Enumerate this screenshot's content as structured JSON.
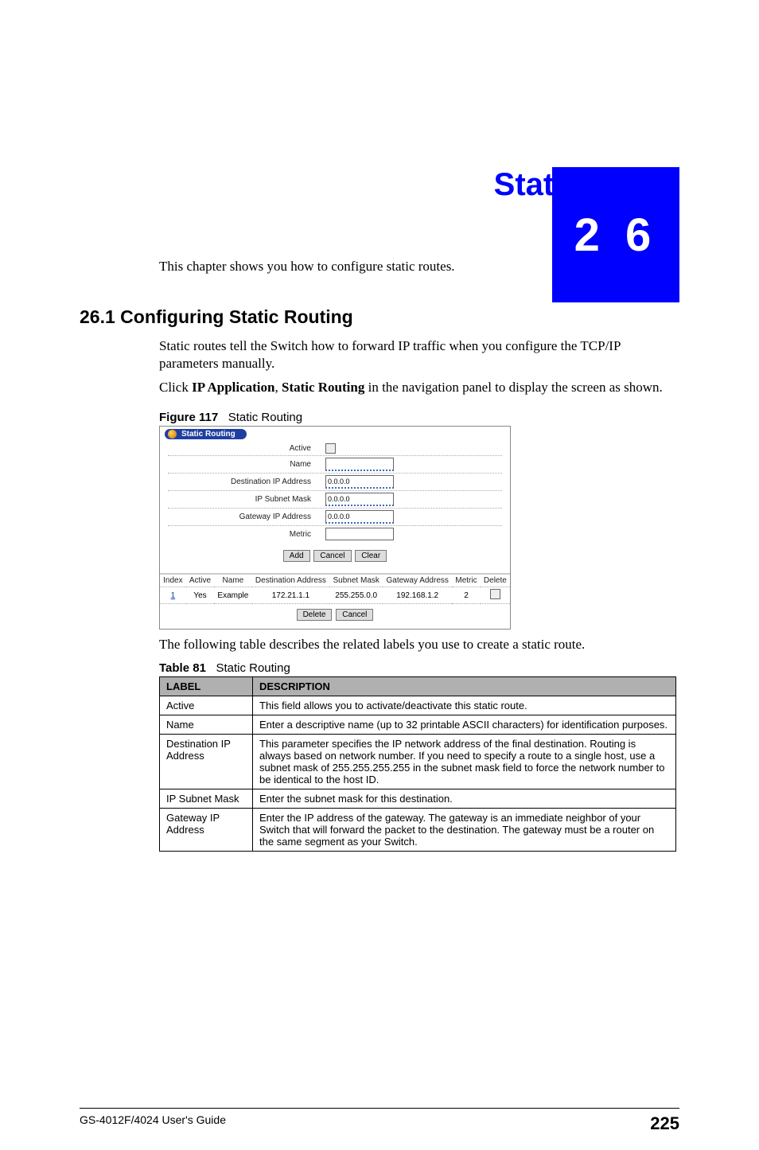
{
  "chapter_number": "2 6",
  "chapter_title": "Static Route",
  "intro": "This chapter shows you how to configure static routes.",
  "section_heading": "26.1  Configuring Static Routing",
  "para1": "Static routes tell the Switch how to forward IP traffic when you configure the TCP/IP parameters manually.",
  "para2_pre": "Click ",
  "para2_b1": "IP Application",
  "para2_sep": ", ",
  "para2_b2": "Static Routing",
  "para2_post": " in the navigation panel to display the screen as shown.",
  "figure": {
    "label": "Figure 117",
    "title": "Static Routing",
    "ui_title": "Static Routing",
    "fields": {
      "active": "Active",
      "name": "Name",
      "dest_ip": "Destination IP Address",
      "subnet": "IP Subnet Mask",
      "gateway": "Gateway IP Address",
      "metric": "Metric"
    },
    "values": {
      "name": "",
      "dest_ip": "0.0.0.0",
      "subnet": "0.0.0.0",
      "gateway": "0.0.0.0",
      "metric": ""
    },
    "buttons": {
      "add": "Add",
      "cancel": "Cancel",
      "clear": "Clear"
    },
    "table": {
      "headers": {
        "index": "Index",
        "active": "Active",
        "name": "Name",
        "dest": "Destination Address",
        "subnet": "Subnet Mask",
        "gateway": "Gateway Address",
        "metric": "Metric",
        "delete": "Delete"
      },
      "row": {
        "index": "1",
        "active": "Yes",
        "name": "Example",
        "dest": "172.21.1.1",
        "subnet": "255.255.0.0",
        "gateway": "192.168.1.2",
        "metric": "2"
      }
    },
    "buttons2": {
      "delete": "Delete",
      "cancel": "Cancel"
    }
  },
  "para3": "The following table describes the related labels you use to create a static route.",
  "table81": {
    "label": "Table 81",
    "title": "Static Routing",
    "headers": {
      "label": "LABEL",
      "desc": "DESCRIPTION"
    },
    "rows": [
      {
        "label": "Active",
        "desc": "This field allows you to activate/deactivate this static route."
      },
      {
        "label": "Name",
        "desc": "Enter a descriptive name (up to 32 printable ASCII characters) for identification purposes."
      },
      {
        "label": "Destination IP Address",
        "desc": "This parameter specifies the IP network address of the final destination. Routing is always based on network number. If you need to specify a route to a single host, use a subnet mask of 255.255.255.255 in the subnet mask field to force the network number to be identical to the host ID."
      },
      {
        "label": "IP Subnet Mask",
        "desc": "Enter the subnet mask for this destination."
      },
      {
        "label": "Gateway IP Address",
        "desc": "Enter the IP address of the gateway. The gateway is an immediate neighbor of your Switch that will forward the packet to the destination. The gateway must be a router on the same segment as your Switch."
      }
    ]
  },
  "footer": {
    "guide": "GS-4012F/4024 User's Guide",
    "page": "225"
  }
}
